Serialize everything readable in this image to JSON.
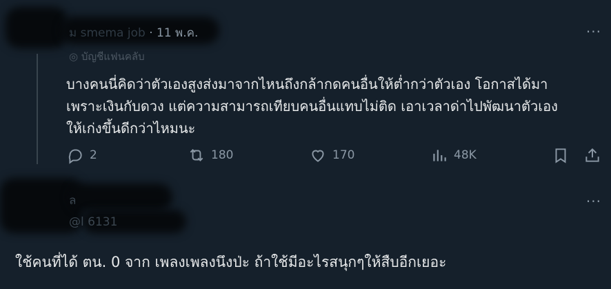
{
  "tweet": {
    "author_name": "ม",
    "author_handle": "smema job",
    "date": "· 11 พ.ค.",
    "label": "บัญชีแฟนคลับ",
    "text_lines": [
      "บางคนนี่คิดว่าตัวเองสูงส่งมาจากไหนถึงกล้ากดคนอื่นให้ต่ำกว่าตัวเอง โอกาสได้มา",
      "เพราะเงินกับดวง แต่ความสามารถเทียบคนอื่นแทบไม่ติด เอาเวลาด่าไปพัฒนาตัวเอง",
      "ให้เก่งขึ้นดีกว่าไหมนะ"
    ],
    "replies": "2",
    "retweets": "180",
    "likes": "170",
    "views": "48K",
    "more": "···"
  },
  "reply": {
    "author_name": "ล",
    "author_handle": "@l        6131",
    "text": "ใช้คนที่ได้ ตน. 0 จาก เพลงเพลงนึงป่ะ ถ้าใช้มีอะไรสนุกๆให้สืบอีกเยอะ",
    "more": "···"
  },
  "icons": [
    "reply-icon",
    "retweet-icon",
    "like-icon",
    "views-icon",
    "bookmark-icon",
    "share-icon",
    "more-icon"
  ],
  "colors": {
    "background": "#15202b",
    "text": "#e7e9ea",
    "secondary": "#8b98a5"
  }
}
